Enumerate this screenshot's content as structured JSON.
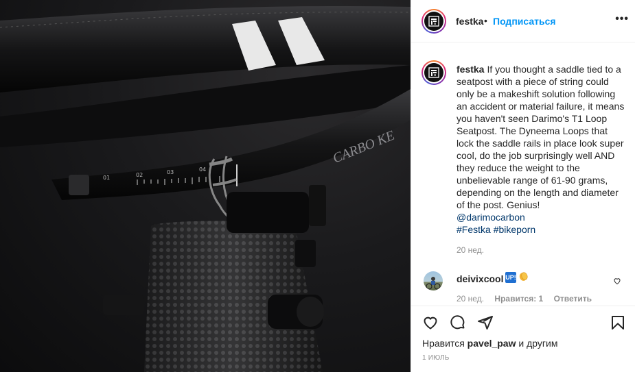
{
  "post": {
    "username": "festka",
    "follow_label": "Подписаться",
    "dot": "•",
    "more_label": "•••",
    "caption": {
      "username": "festka",
      "text": "If you thought a saddle tied to a seatpost with a piece of string could only be a makeshift solution following an accident or material failure, it means you haven't seen Darimo's T1 Loop Seatpost. The Dyneema Loops that lock the saddle rails in place look super cool, do the job surprisingly well AND they reduce the weight to the unbelievable range of 61-90 grams, depending on the length and diameter of the post. Genius!",
      "mention": "@darimocarbon",
      "hashtags": "#Festka #bikeporn",
      "time": "20 нед."
    },
    "comment": {
      "username": "deivixcool",
      "emoji_box": "🆙",
      "emoji_clap": "👏",
      "time": "20 нед.",
      "likes": "Нравится: 1",
      "reply": "Ответить"
    },
    "likes_prefix": "Нравится",
    "likes_user": "pavel_paw",
    "likes_suffix": "и другим",
    "date": "1 ИЮЛЬ"
  },
  "photo": {
    "frame_text": "CARBO KE",
    "scale_labels": [
      "01",
      "02",
      "03",
      "04"
    ]
  }
}
